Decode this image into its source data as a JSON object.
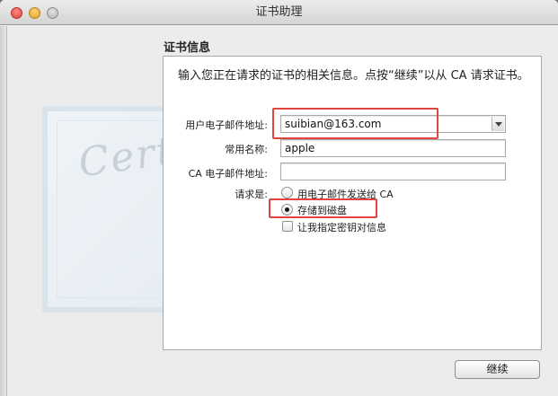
{
  "window": {
    "title": "证书助理"
  },
  "form": {
    "section_title": "证书信息",
    "intro": "输入您正在请求的证书的相关信息。点按“继续”以从 CA 请求证书。",
    "user_email_label": "用户电子邮件地址:",
    "user_email_value": "suibian@163.com",
    "common_name_label": "常用名称:",
    "common_name_value": "apple",
    "ca_email_label": "CA 电子邮件地址:",
    "ca_email_value": "",
    "request_label": "请求是:",
    "options": {
      "email_ca": "用电子邮件发送给 CA",
      "save_to_disk": "存储到磁盘",
      "specify_key_pair": "让我指定密钥对信息"
    },
    "selected_option": "save_to_disk",
    "specify_key_pair_checked": false
  },
  "watermark": {
    "text": "Certific"
  },
  "buttons": {
    "continue": "继续"
  },
  "colors": {
    "highlight": "#e0463f"
  }
}
